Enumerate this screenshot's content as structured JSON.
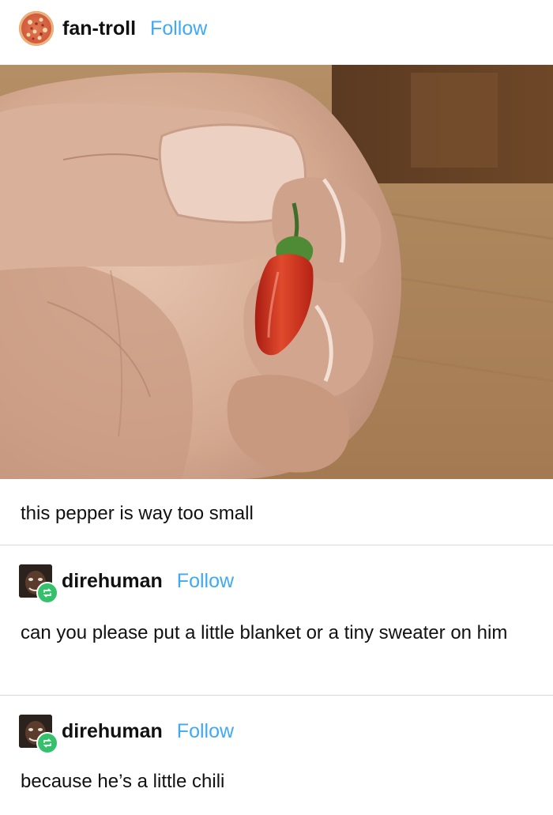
{
  "original_post": {
    "username": "fan-troll",
    "follow_label": "Follow",
    "avatar_icon": "pizza-avatar",
    "image_description_icon": "photo",
    "caption": "this pepper is way too small"
  },
  "reblogs": [
    {
      "username": "direhuman",
      "follow_label": "Follow",
      "avatar_icon": "face-avatar",
      "badge_icon": "reblog-icon",
      "text": "can you please put a little blanket or a tiny sweater on him"
    },
    {
      "username": "direhuman",
      "follow_label": "Follow",
      "avatar_icon": "face-avatar",
      "badge_icon": "reblog-icon",
      "text": "because he’s a little chili"
    }
  ],
  "colors": {
    "follow": "#3fa9f5",
    "reblog_badge": "#35c16b",
    "divider": "#d8d8d8"
  }
}
